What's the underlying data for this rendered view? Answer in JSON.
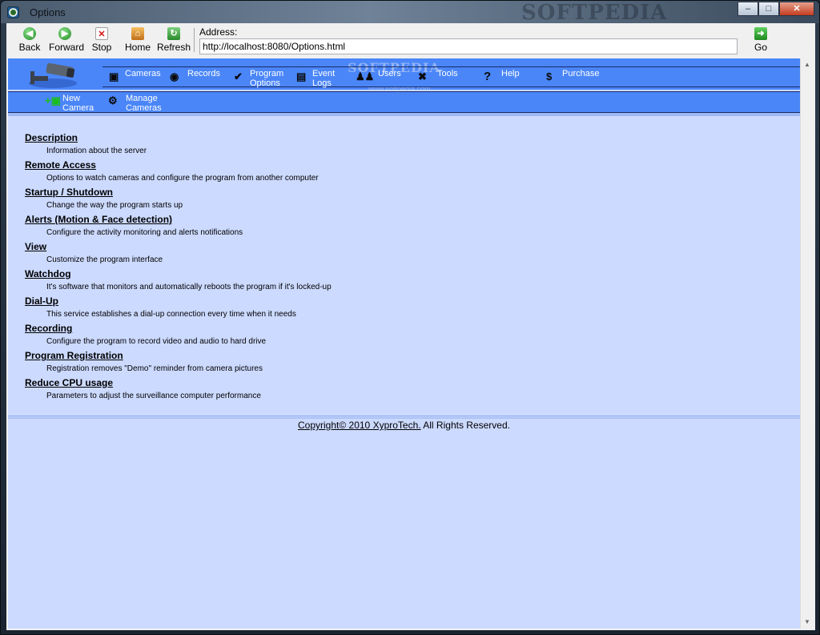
{
  "window": {
    "title": "Options",
    "watermark": "SOFTPEDIA"
  },
  "toolbar": {
    "back": "Back",
    "forward": "Forward",
    "stop": "Stop",
    "home": "Home",
    "refresh": "Refresh",
    "address_label": "Address:",
    "address_value": "http://localhost:8080/Options.html",
    "go": "Go"
  },
  "nav": {
    "items": [
      {
        "label_1": "Cameras",
        "label_2": "",
        "icon": "camera-icon"
      },
      {
        "label_1": "Records",
        "label_2": "",
        "icon": "disc-icon"
      },
      {
        "label_1": "Program",
        "label_2": "Options",
        "icon": "checkmark-icon"
      },
      {
        "label_1": "Event",
        "label_2": "Logs",
        "icon": "document-icon"
      },
      {
        "label_1": "Users",
        "label_2": "",
        "icon": "users-icon"
      },
      {
        "label_1": "Tools",
        "label_2": "",
        "icon": "tools-icon"
      },
      {
        "label_1": "Help",
        "label_2": "",
        "icon": "help-icon"
      },
      {
        "label_1": "Purchase",
        "label_2": "",
        "icon": "dollar-icon"
      }
    ],
    "sub_items": [
      {
        "label_1": "New",
        "label_2": "Camera",
        "icon": "new-camera-icon"
      },
      {
        "label_1": "Manage",
        "label_2": "Cameras",
        "icon": "manage-cameras-icon"
      }
    ],
    "watermark": "SOFTPEDIA",
    "watermark_url": "www.softpedia.com"
  },
  "options": [
    {
      "title": "Description",
      "desc": "Information about the server"
    },
    {
      "title": "Remote Access",
      "desc": "Options to watch cameras and configure the program from another computer"
    },
    {
      "title": "Startup / Shutdown",
      "desc": "Change the way the program starts up"
    },
    {
      "title": "Alerts (Motion & Face detection)",
      "desc": "Configure the activity monitoring and alerts notifications"
    },
    {
      "title": "View",
      "desc": "Customize the program interface"
    },
    {
      "title": "Watchdog",
      "desc": "It's software that monitors and automatically reboots the program if it's locked-up"
    },
    {
      "title": "Dial-Up",
      "desc": "This service establishes a dial-up connection every time when it needs"
    },
    {
      "title": "Recording",
      "desc": "Configure the program to record video and audio to hard drive"
    },
    {
      "title": "Program Registration",
      "desc": "Registration removes \"Demo\" reminder from camera pictures"
    },
    {
      "title": "Reduce CPU usage",
      "desc": "Parameters to adjust the surveillance computer performance"
    }
  ],
  "footer": {
    "link": "Copyright© 2010 XyproTech.",
    "rest": " All Rights Reserved."
  }
}
